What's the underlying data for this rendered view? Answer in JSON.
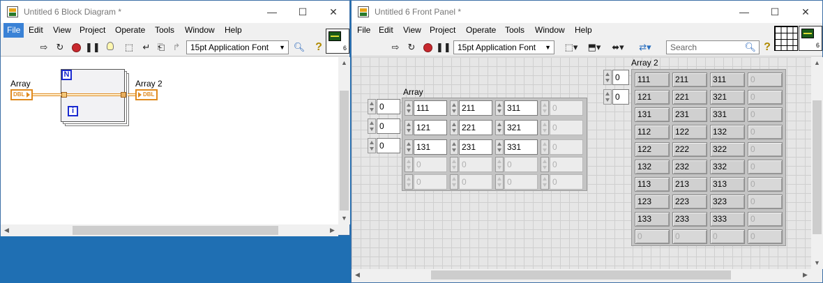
{
  "block_diagram": {
    "title": "Untitled 6 Block Diagram *",
    "window_controls": [
      "—",
      "☐",
      "✕"
    ],
    "menu": [
      "File",
      "Edit",
      "View",
      "Project",
      "Operate",
      "Tools",
      "Window",
      "Help"
    ],
    "active_menu": "File",
    "font_select": "15pt Application Font",
    "vi_icon_number": "6",
    "terminals": {
      "input_label": "Array",
      "output_label": "Array 2",
      "input_type": "DBL",
      "output_type": "DBL"
    },
    "loop": {
      "count_label": "N",
      "iteration_label": "i"
    }
  },
  "front_panel": {
    "title": "Untitled 6 Front Panel *",
    "window_controls": [
      "—",
      "☐",
      "✕"
    ],
    "menu": [
      "File",
      "Edit",
      "View",
      "Project",
      "Operate",
      "Tools",
      "Window",
      "Help"
    ],
    "font_select": "15pt Application Font",
    "search": {
      "placeholder": "Search"
    },
    "vi_icon_number": "6",
    "array_control": {
      "label": "Array",
      "indices": [
        "0",
        "0",
        "0"
      ],
      "rows": [
        [
          "111",
          "211",
          "311",
          "0"
        ],
        [
          "121",
          "221",
          "321",
          "0"
        ],
        [
          "131",
          "231",
          "331",
          "0"
        ],
        [
          "0",
          "0",
          "0",
          "0"
        ],
        [
          "0",
          "0",
          "0",
          "0"
        ]
      ],
      "active_rows": 3,
      "active_cols": 3
    },
    "array_indicator": {
      "label": "Array 2",
      "indices": [
        "0",
        "0"
      ],
      "rows": [
        [
          "111",
          "211",
          "311",
          "0"
        ],
        [
          "121",
          "221",
          "321",
          "0"
        ],
        [
          "131",
          "231",
          "331",
          "0"
        ],
        [
          "112",
          "122",
          "132",
          "0"
        ],
        [
          "122",
          "222",
          "322",
          "0"
        ],
        [
          "132",
          "232",
          "332",
          "0"
        ],
        [
          "113",
          "213",
          "313",
          "0"
        ],
        [
          "123",
          "223",
          "323",
          "0"
        ],
        [
          "133",
          "233",
          "333",
          "0"
        ],
        [
          "0",
          "0",
          "0",
          "0"
        ]
      ],
      "active_rows": 9,
      "active_cols": 3
    }
  }
}
